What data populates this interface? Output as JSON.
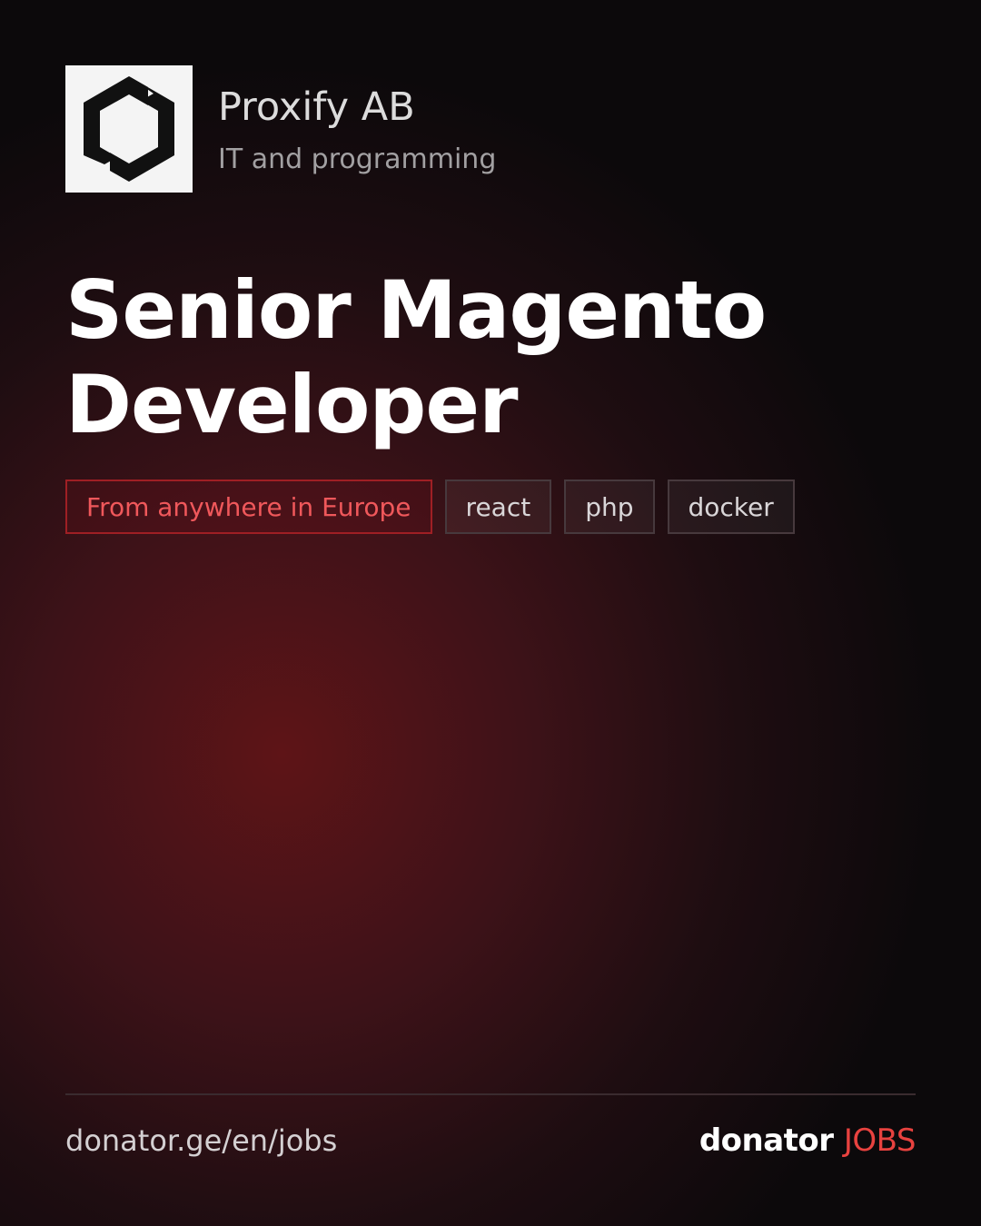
{
  "company": {
    "name": "Proxify AB",
    "category": "IT and programming",
    "logo_icon": "proxify-hexagon-logo"
  },
  "job": {
    "title": "Senior Magento Developer"
  },
  "tags": {
    "location": "From anywhere in Europe",
    "skills": [
      "react",
      "php",
      "docker"
    ]
  },
  "footer": {
    "url": "donator.ge/en/jobs",
    "brand_primary": "donator",
    "brand_accent": "JOBS"
  },
  "colors": {
    "background": "#0c090b",
    "glow": "#5e1417",
    "accent": "#e8423f",
    "location_text": "#f0585b",
    "location_border": "#9f1f24"
  }
}
